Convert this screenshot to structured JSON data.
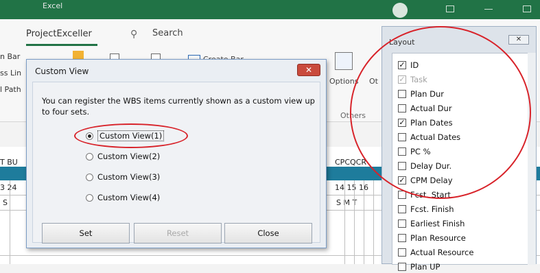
{
  "window": {
    "app_title": "Excel"
  },
  "ribbon": {
    "active_tab": "ProjectExceller",
    "search_label": "Search",
    "left_labels": [
      "n Bar",
      "ss Lin",
      "l Path"
    ],
    "create_bar": "Create Bar",
    "options_label": "Options",
    "ot_label": "Ot",
    "others_group": "Others"
  },
  "grid": {
    "left_header": "T BU",
    "left_day": "3 24",
    "left_dow": "S",
    "right_header": "CPCQCR",
    "right_days": "14 15 16",
    "right_dows": "S  M  T"
  },
  "custom_view_dialog": {
    "title": "Custom View",
    "close_symbol": "✕",
    "description": "You can register the WBS items currently shown as a custom view up to four sets.",
    "options": [
      {
        "label": "Custom View(1)",
        "selected": true
      },
      {
        "label": "Custom View(2)",
        "selected": false
      },
      {
        "label": "Custom View(3)",
        "selected": false
      },
      {
        "label": "Custom View(4)",
        "selected": false
      }
    ],
    "buttons": {
      "set": "Set",
      "reset": "Reset",
      "close": "Close"
    }
  },
  "layout_panel": {
    "title": "Layout",
    "close_symbol": "✕",
    "items": [
      {
        "label": "ID",
        "checked": true,
        "enabled": true
      },
      {
        "label": "Task",
        "checked": true,
        "enabled": false
      },
      {
        "label": "Plan Dur",
        "checked": false,
        "enabled": true
      },
      {
        "label": "Actual Dur",
        "checked": false,
        "enabled": true
      },
      {
        "label": "Plan Dates",
        "checked": true,
        "enabled": true
      },
      {
        "label": "Actual Dates",
        "checked": false,
        "enabled": true
      },
      {
        "label": "PC %",
        "checked": false,
        "enabled": true
      },
      {
        "label": "Delay Dur.",
        "checked": false,
        "enabled": true
      },
      {
        "label": "CPM Delay",
        "checked": true,
        "enabled": true
      },
      {
        "label": "Fcst. Start",
        "checked": false,
        "enabled": true
      },
      {
        "label": "Fcst. Finish",
        "checked": false,
        "enabled": true
      },
      {
        "label": "Earliest Finish",
        "checked": false,
        "enabled": true
      },
      {
        "label": "Plan Resource",
        "checked": false,
        "enabled": true
      },
      {
        "label": "Actual Resource",
        "checked": false,
        "enabled": true
      },
      {
        "label": "Plan UP",
        "checked": false,
        "enabled": true
      }
    ]
  },
  "colors": {
    "excel_green": "#217346",
    "annotation_red": "#d8232a",
    "band_teal": "#1e7c9c"
  }
}
